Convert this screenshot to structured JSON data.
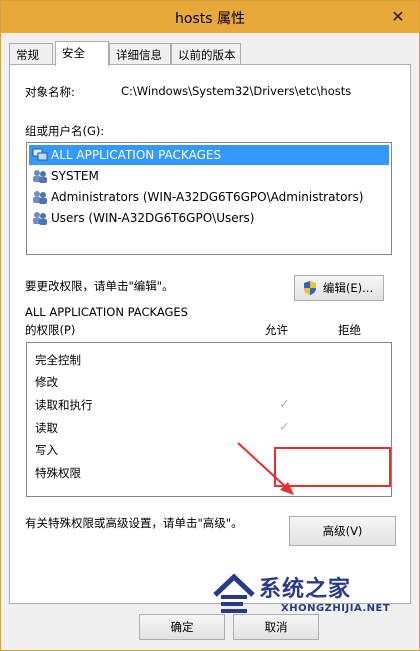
{
  "window": {
    "title": "hosts 属性",
    "close_glyph": "✕"
  },
  "tabs": [
    {
      "label": "常规",
      "active": false
    },
    {
      "label": "安全",
      "active": true
    },
    {
      "label": "详细信息",
      "active": false
    },
    {
      "label": "以前的版本",
      "active": false
    }
  ],
  "object": {
    "label": "对象名称:",
    "value": "C:\\Windows\\System32\\Drivers\\etc\\hosts"
  },
  "groups": {
    "label": "组或用户名(G):",
    "items": [
      {
        "name": "ALL APPLICATION PACKAGES",
        "icon": "packages-icon",
        "selected": true
      },
      {
        "name": "SYSTEM",
        "icon": "users-icon",
        "selected": false
      },
      {
        "name": "Administrators (WIN-A32DG6T6GPO\\Administrators)",
        "icon": "users-icon",
        "selected": false
      },
      {
        "name": "Users (WIN-A32DG6T6GPO\\Users)",
        "icon": "users-icon",
        "selected": false
      }
    ]
  },
  "edit": {
    "hint": "要更改权限，请单击\"编辑\"。",
    "button_label": "编辑(E)..."
  },
  "permissions": {
    "principal": "ALL APPLICATION PACKAGES",
    "label": "的权限(P)",
    "allow_header": "允许",
    "deny_header": "拒绝",
    "check_glyph": "✓",
    "rows": [
      {
        "name": "完全控制",
        "allow": false,
        "deny": false
      },
      {
        "name": "修改",
        "allow": false,
        "deny": false
      },
      {
        "name": "读取和执行",
        "allow": true,
        "deny": false
      },
      {
        "name": "读取",
        "allow": true,
        "deny": false
      },
      {
        "name": "写入",
        "allow": false,
        "deny": false
      },
      {
        "name": "特殊权限",
        "allow": false,
        "deny": false
      }
    ]
  },
  "advanced": {
    "hint": "有关特殊权限或高级设置，请单击\"高级\"。",
    "button_label": "高级(V)"
  },
  "footer": {
    "ok_label": "确定",
    "cancel_label": "取消"
  },
  "watermark": {
    "text": "系统之家",
    "url": "XHONGZHIJIA.NET"
  },
  "colors": {
    "titlebar": "#e8a83a",
    "selection": "#3399ff",
    "annotation": "#e53030"
  }
}
